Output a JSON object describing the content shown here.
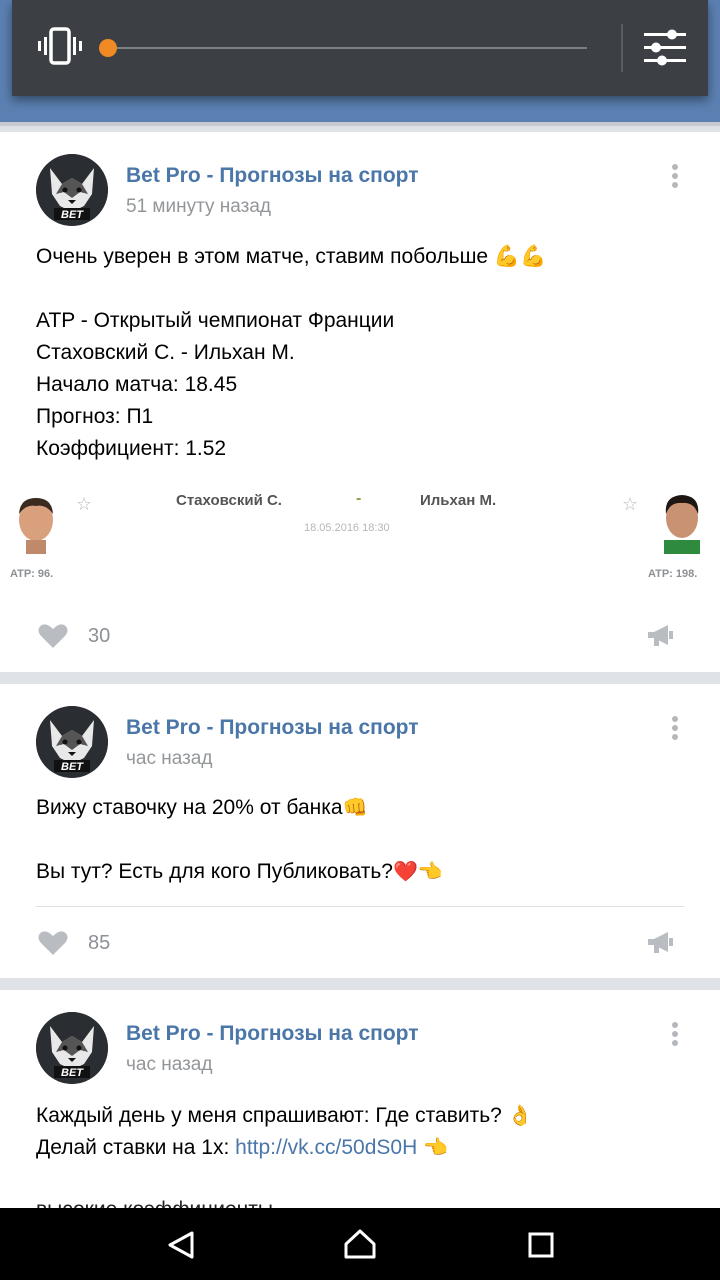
{
  "volume_panel": {
    "level": 0.0,
    "vibrate_icon": "vibrate-icon",
    "settings_icon": "equalizer-settings-icon",
    "accent_color": "#f08a24"
  },
  "posts": [
    {
      "author": "Bet Pro - Прогнозы на спорт",
      "time": "51 минуту назад",
      "lines": [
        "Очень уверен в этом матче, ставим побольше 💪💪",
        "",
        "ATP - Открытый чемпионат Франции",
        "Стаховский С. - Ильхан М.",
        "Начало матча: 18.45",
        "Прогноз: П1",
        "Коэффициент: 1.52"
      ],
      "match": {
        "player1": "Стаховский С.",
        "separator": "-",
        "player2": "Ильхан М.",
        "datetime": "18.05.2016 18:30",
        "player1_rank": "ATP: 96.",
        "player2_rank": "ATP: 198."
      },
      "likes": "30"
    },
    {
      "author": "Bet Pro - Прогнозы на спорт",
      "time": "час назад",
      "line1": "Вижу ставочку на 20% от банка",
      "line1_emoji": "👊",
      "line2": "Вы тут? Есть для кого Публиковать?",
      "line2_emoji": "❤️👈",
      "likes": "85"
    },
    {
      "author": "Bet Pro - Прогнозы на спорт",
      "time": "час назад",
      "line1": "Каждый день у меня спрашивают: Где ставить?",
      "line1_emoji": "👌",
      "line2_prefix": "Делай ставки на 1х: ",
      "line2_link": "http://vk.cc/50dS0H",
      "line2_emoji": "👈",
      "peek": "высокие коэффициенты"
    }
  ],
  "colors": {
    "header_blue": "#5b80b2",
    "link_blue": "#4a76a8"
  }
}
